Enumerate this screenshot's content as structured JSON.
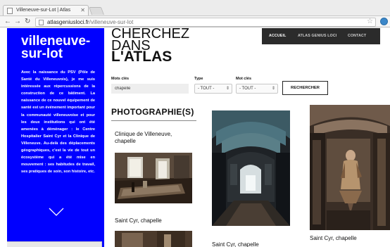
{
  "browser": {
    "tab_title": "Villeneuve-sur-Lot | Atlas",
    "url_host": "atlasgeniusloci.fr",
    "url_path": "/villeneuve-sur-lot"
  },
  "sidebar": {
    "site_title_line1": "villeneuve-",
    "site_title_line2": "sur-lot",
    "intro": "Avec la naissance du PSV (Pôle de Santé du Villeneuvois), je me suis intéressée aux répercussions de la construction de ce bâtiment. La naissance de ce nouvel équipement de santé est un événement important pour la communauté villeneuvoise et pour les deux institutions qui ont été amenées à déménager : le Centre Hospitalier Saint Cyr et la Clinique de Villeneuve. Au-delà des déplacements géographiques, c'est la vie de tout un écosystème qui a été mise en mouvement : ses habitudes de travail, ses pratiques de soin, son histoire, etc."
  },
  "heading": {
    "line1": "CHERCHEZ",
    "line2": "DANS",
    "line3": "L'ATLAS"
  },
  "nav": {
    "items": [
      "ACCUEIL",
      "ATLAS GENIUS LOCI",
      "CONTACT"
    ]
  },
  "search": {
    "keywords_label": "Mots clés",
    "keywords_value": "chapelle",
    "type_label": "Type",
    "type_value": "- TOUT -",
    "motcles_label": "Mot clés",
    "motcles_value": "- TOUT -",
    "button_label": "RECHERCHER"
  },
  "results": {
    "heading": "PHOTOGRAPHIE(S)",
    "cards": [
      {
        "title": "Clinique de Villeneuve, chapelle"
      },
      {
        "title": "Saint Cyr, chapelle"
      },
      {
        "title": "Saint Cyr, chapelle"
      },
      {
        "title": "Saint Cyr, chapelle"
      }
    ]
  },
  "colors": {
    "sidebar": "#0000ff",
    "nav_bar": "#2b2b2b"
  }
}
